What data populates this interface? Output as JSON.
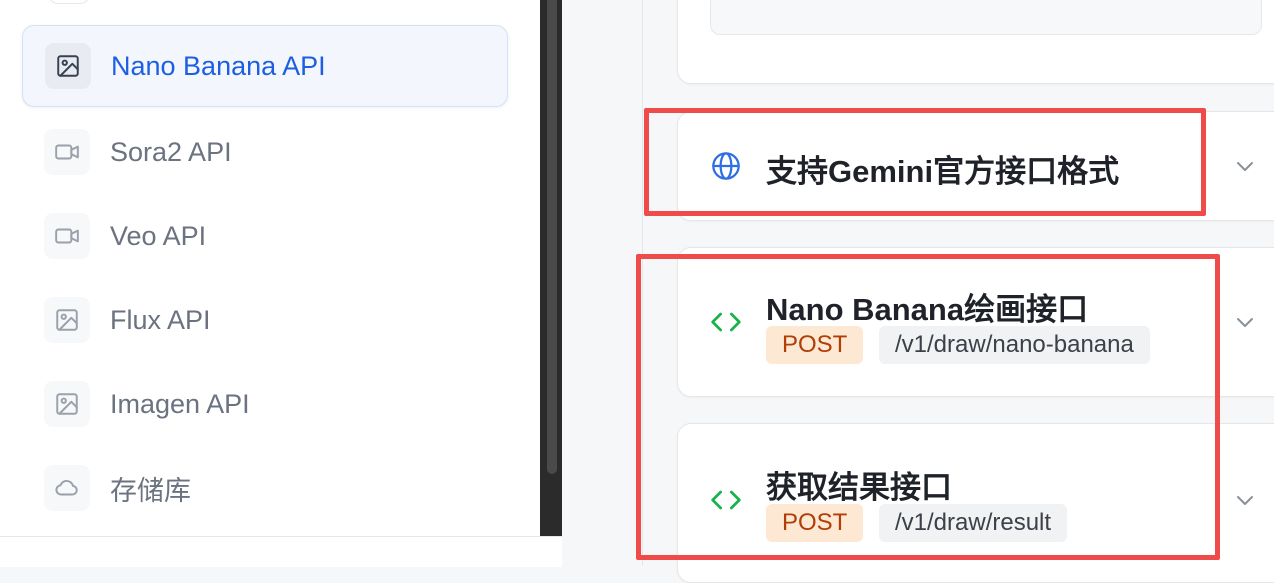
{
  "sidebar": {
    "items": [
      {
        "label": "Nano Banana API",
        "icon": "image-icon",
        "active": true
      },
      {
        "label": "Sora2 API",
        "icon": "video-icon",
        "active": false
      },
      {
        "label": "Veo API",
        "icon": "video-icon",
        "active": false
      },
      {
        "label": "Flux API",
        "icon": "image-icon",
        "active": false
      },
      {
        "label": "Imagen API",
        "icon": "image-icon",
        "active": false
      },
      {
        "label": "存储库",
        "icon": "cloud-icon",
        "active": false
      }
    ]
  },
  "sections": {
    "gemini": {
      "title": "支持Gemini官方接口格式",
      "icon": "globe-icon"
    },
    "endpoints": [
      {
        "title": "Nano Banana绘画接口",
        "method": "POST",
        "path": "/v1/draw/nano-banana",
        "icon": "code-icon"
      },
      {
        "title": "获取结果接口",
        "method": "POST",
        "path": "/v1/draw/result",
        "icon": "code-icon"
      }
    ]
  },
  "colors": {
    "accent": "#1d5fe0",
    "method_bg": "#fde9d3",
    "method_text": "#b13d07",
    "code_icon": "#16b34a",
    "highlight": "#ef4b4b"
  }
}
